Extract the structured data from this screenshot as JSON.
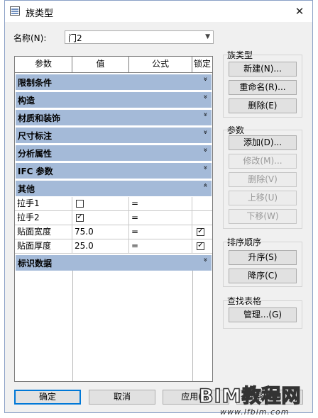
{
  "window": {
    "title": "族类型",
    "close_glyph": "✕"
  },
  "name_field": {
    "label": "名称(N):",
    "value": "门2"
  },
  "table": {
    "headers": [
      "参数",
      "值",
      "公式",
      "锁定"
    ],
    "groups": [
      "限制条件",
      "构造",
      "材质和装饰",
      "尺寸标注",
      "分析属性",
      "IFC 参数",
      "其他",
      "标识数据"
    ],
    "collapsed_glyph": "»",
    "expanded_glyph": "«",
    "rows": [
      {
        "name": "拉手1",
        "value": "",
        "formula": "=",
        "checked": false,
        "locked": null
      },
      {
        "name": "拉手2",
        "value": "",
        "formula": "=",
        "checked": true,
        "locked": null
      },
      {
        "name": "贴面宽度",
        "value": "75.0",
        "formula": "=",
        "checked": null,
        "locked": true
      },
      {
        "name": "贴面厚度",
        "value": "25.0",
        "formula": "=",
        "checked": null,
        "locked": true
      }
    ]
  },
  "family_types": {
    "label": "族类型",
    "new": "新建(N)...",
    "rename": "重命名(R)...",
    "delete": "删除(E)"
  },
  "parameters": {
    "label": "参数",
    "add": "添加(D)...",
    "modify": "修改(M)...",
    "remove": "删除(V)",
    "up": "上移(U)",
    "down": "下移(W)"
  },
  "sort": {
    "label": "排序顺序",
    "asc": "升序(S)",
    "desc": "降序(C)"
  },
  "lookup": {
    "label": "查找表格",
    "manage": "管理...(G)"
  },
  "footer": {
    "ok": "确定",
    "cancel": "取消",
    "apply": "应用(A)",
    "help": "帮助(H)"
  },
  "watermark": {
    "main": "BIM教程网",
    "url": "www.lfbim.com"
  }
}
